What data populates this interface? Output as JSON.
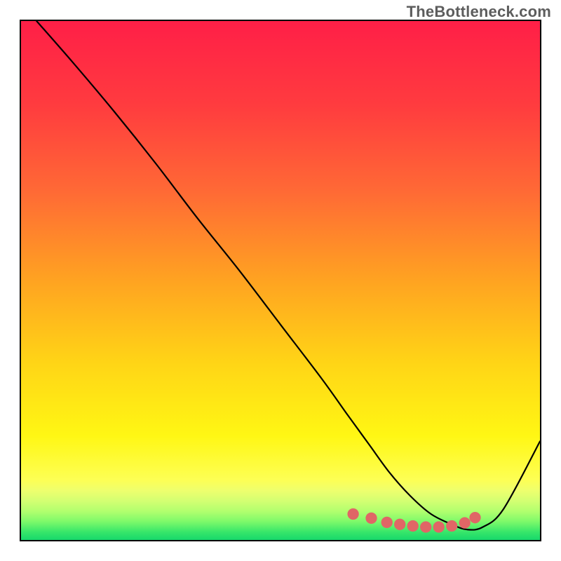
{
  "watermark": "TheBottleneck.com",
  "chart_data": {
    "type": "line",
    "title": "",
    "xlabel": "",
    "ylabel": "",
    "xlim": [
      0,
      100
    ],
    "ylim": [
      0,
      100
    ],
    "grid": false,
    "legend": false,
    "background_gradient": {
      "orientation": "vertical",
      "stops": [
        {
          "offset": 0.0,
          "color": "#ff1f47"
        },
        {
          "offset": 0.16,
          "color": "#ff3b3f"
        },
        {
          "offset": 0.33,
          "color": "#ff6a35"
        },
        {
          "offset": 0.5,
          "color": "#ffa321"
        },
        {
          "offset": 0.66,
          "color": "#ffd516"
        },
        {
          "offset": 0.8,
          "color": "#fff714"
        },
        {
          "offset": 0.885,
          "color": "#fdff55"
        },
        {
          "offset": 0.905,
          "color": "#eeff6e"
        },
        {
          "offset": 0.925,
          "color": "#d3ff72"
        },
        {
          "offset": 0.945,
          "color": "#b1ff6e"
        },
        {
          "offset": 0.965,
          "color": "#7cf96a"
        },
        {
          "offset": 0.985,
          "color": "#36e66a"
        },
        {
          "offset": 1.0,
          "color": "#17d86b"
        }
      ]
    },
    "series": [
      {
        "name": "bottleneck-curve",
        "color": "#000000",
        "x": [
          3,
          10,
          18,
          26,
          34,
          42,
          50,
          58,
          63,
          67,
          71,
          75,
          79,
          83,
          86,
          89,
          93,
          100
        ],
        "y": [
          100,
          92,
          82.5,
          72.5,
          62,
          52,
          41.5,
          31,
          24,
          18.5,
          13,
          8.5,
          5,
          3,
          2,
          2.5,
          6,
          19
        ]
      }
    ],
    "markers": {
      "name": "sweet-spot-dots",
      "color": "#e06666",
      "radius_pct": 1.1,
      "x": [
        64,
        67.5,
        70.5,
        73,
        75.5,
        78,
        80.5,
        83,
        85.5,
        87.5
      ],
      "y": [
        5.0,
        4.2,
        3.4,
        3.0,
        2.7,
        2.5,
        2.5,
        2.7,
        3.3,
        4.3
      ]
    }
  }
}
